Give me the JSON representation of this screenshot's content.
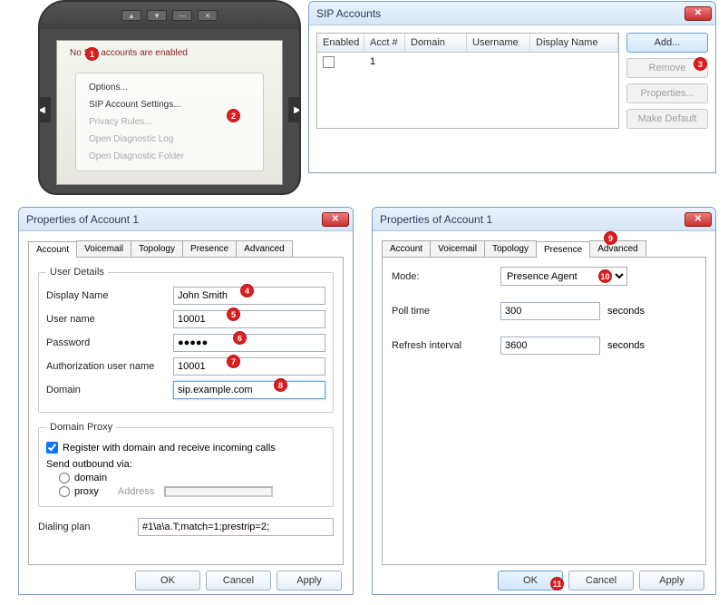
{
  "phone": {
    "status": "No SIP accounts are enabled",
    "menu": {
      "options": "Options...",
      "sip_settings": "SIP Account Settings...",
      "privacy": "Privacy Rules...",
      "diag_log": "Open Diagnostic Log",
      "diag_folder": "Open Diagnostic Folder"
    },
    "top_buttons": {
      "left": "▲",
      "down": "▼",
      "dash": "—",
      "x": "✕"
    }
  },
  "sip_accounts": {
    "title": "SIP Accounts",
    "columns": {
      "enabled": "Enabled",
      "acct": "Acct #",
      "domain": "Domain",
      "username": "Username",
      "display": "Display Name"
    },
    "rows": [
      {
        "enabled": false,
        "acct": "1",
        "domain": "",
        "username": "",
        "display": ""
      }
    ],
    "buttons": {
      "add": "Add...",
      "remove": "Remove",
      "properties": "Properties...",
      "make_default": "Make Default"
    }
  },
  "props1": {
    "title": "Properties of Account 1",
    "tabs": {
      "account": "Account",
      "voicemail": "Voicemail",
      "topology": "Topology",
      "presence": "Presence",
      "advanced": "Advanced"
    },
    "user_details_legend": "User Details",
    "fields": {
      "display_name_label": "Display Name",
      "display_name": "John Smith",
      "user_name_label": "User name",
      "user_name": "10001",
      "password_label": "Password",
      "password": "●●●●●",
      "auth_user_label": "Authorization user name",
      "auth_user": "10001",
      "domain_label": "Domain",
      "domain": "sip.example.com"
    },
    "domain_proxy_legend": "Domain Proxy",
    "register_label": "Register with domain and receive incoming calls",
    "send_outbound_label": "Send outbound via:",
    "radio_domain": "domain",
    "radio_proxy": "proxy",
    "address_label": "Address",
    "dialing_plan_label": "Dialing plan",
    "dialing_plan": "#1\\a\\a.T;match=1;prestrip=2;",
    "buttons": {
      "ok": "OK",
      "cancel": "Cancel",
      "apply": "Apply"
    }
  },
  "props2": {
    "title": "Properties of Account 1",
    "tabs": {
      "account": "Account",
      "voicemail": "Voicemail",
      "topology": "Topology",
      "presence": "Presence",
      "advanced": "Advanced"
    },
    "mode_label": "Mode:",
    "mode_value": "Presence Agent",
    "poll_label": "Poll time",
    "poll_value": "300",
    "refresh_label": "Refresh interval",
    "refresh_value": "3600",
    "seconds": "seconds",
    "buttons": {
      "ok": "OK",
      "cancel": "Cancel",
      "apply": "Apply"
    }
  },
  "callouts": {
    "1": "1",
    "2": "2",
    "3": "3",
    "4": "4",
    "5": "5",
    "6": "6",
    "7": "7",
    "8": "8",
    "9": "9",
    "10": "10",
    "11": "11"
  }
}
